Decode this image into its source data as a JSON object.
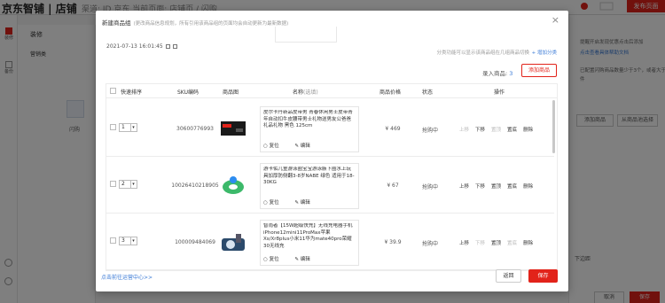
{
  "background": {
    "logo": "京东智铺 | 店铺",
    "shop_hint": "渠道: JD 京东  当前页面: 店铺页 / 闪购",
    "publish_button": "发布页面",
    "left_rail": [
      "装修",
      "备份"
    ],
    "panel_title": "装修",
    "panel_tab": "营销类",
    "panel_item": "闪购",
    "right_text": [
      "提醒开启发现优惠点击后添加",
      "点击查看具体帮助文档",
      "已配置闪购商品数量少于3个，或者大于",
      "件"
    ],
    "right_buttons": [
      "添加商品",
      "从商品池选择"
    ],
    "bottom_hint": "下边距",
    "cancel": "取消",
    "save": "保存",
    "top_icons": [
      "notification-icon",
      "help-icon",
      "settings-icon"
    ]
  },
  "modal": {
    "title": "新建商品组",
    "title_hint": "(更改商品信息规划，所有引用该商品组的页面均会自动更新为最新数据)",
    "date": "2021-07-13 16:01:45",
    "note": "分类功能可以显示该商品组在几组商品切换",
    "note_link": "+ 增加分类",
    "count_label": "录入商品:",
    "count_value": "3",
    "add_button": "添加商品",
    "columns": {
      "sort": "快速排序",
      "sku": "SKU编码",
      "image": "商品图",
      "name": "名称",
      "name_sub": "(选填)",
      "price": "商品价格",
      "status": "状态",
      "ops": "操作"
    },
    "rows": [
      {
        "order": "1",
        "sku": "30600776993",
        "name": "皮尔卡丹新品皮带男 青春休闲男士皮带青年自动扣牛皮腰带男士礼物送男友公爸爸礼品礼物 黑色 125cm",
        "price": "¥ 469",
        "status": "抢购中",
        "ops": [
          "上移",
          "下移",
          "置顶",
          "置底",
          "删除"
        ],
        "ops_off": [
          true,
          false,
          true,
          false,
          false
        ]
      },
      {
        "order": "2",
        "sku": "10026410218905",
        "name": "游卡佑儿童游泳圈宝宝游泳腋下圈水上玩具加厚防侧翻3-8岁NABE 绿色 适用于18-30KG",
        "price": "¥ 67",
        "status": "抢购中",
        "ops": [
          "上移",
          "下移",
          "置顶",
          "置底",
          "删除"
        ],
        "ops_off": [
          false,
          false,
          false,
          false,
          false
        ]
      },
      {
        "order": "3",
        "sku": "100009484069",
        "name": "智雨者【15W超级快充】无线充电器手机iPhone12mini11ProMax苹果Xs/Xr8plus小米11华为mate40pro荣耀30无线充",
        "price": "¥ 39.9",
        "status": "抢购中",
        "ops": [
          "上移",
          "下移",
          "置顶",
          "置底",
          "删除"
        ],
        "ops_off": [
          false,
          true,
          false,
          true,
          false
        ]
      }
    ],
    "row_actions": [
      "复位",
      "编辑"
    ],
    "footer_link": "点击前往运营中心>>",
    "back_button": "返回",
    "save_button": "保存"
  }
}
